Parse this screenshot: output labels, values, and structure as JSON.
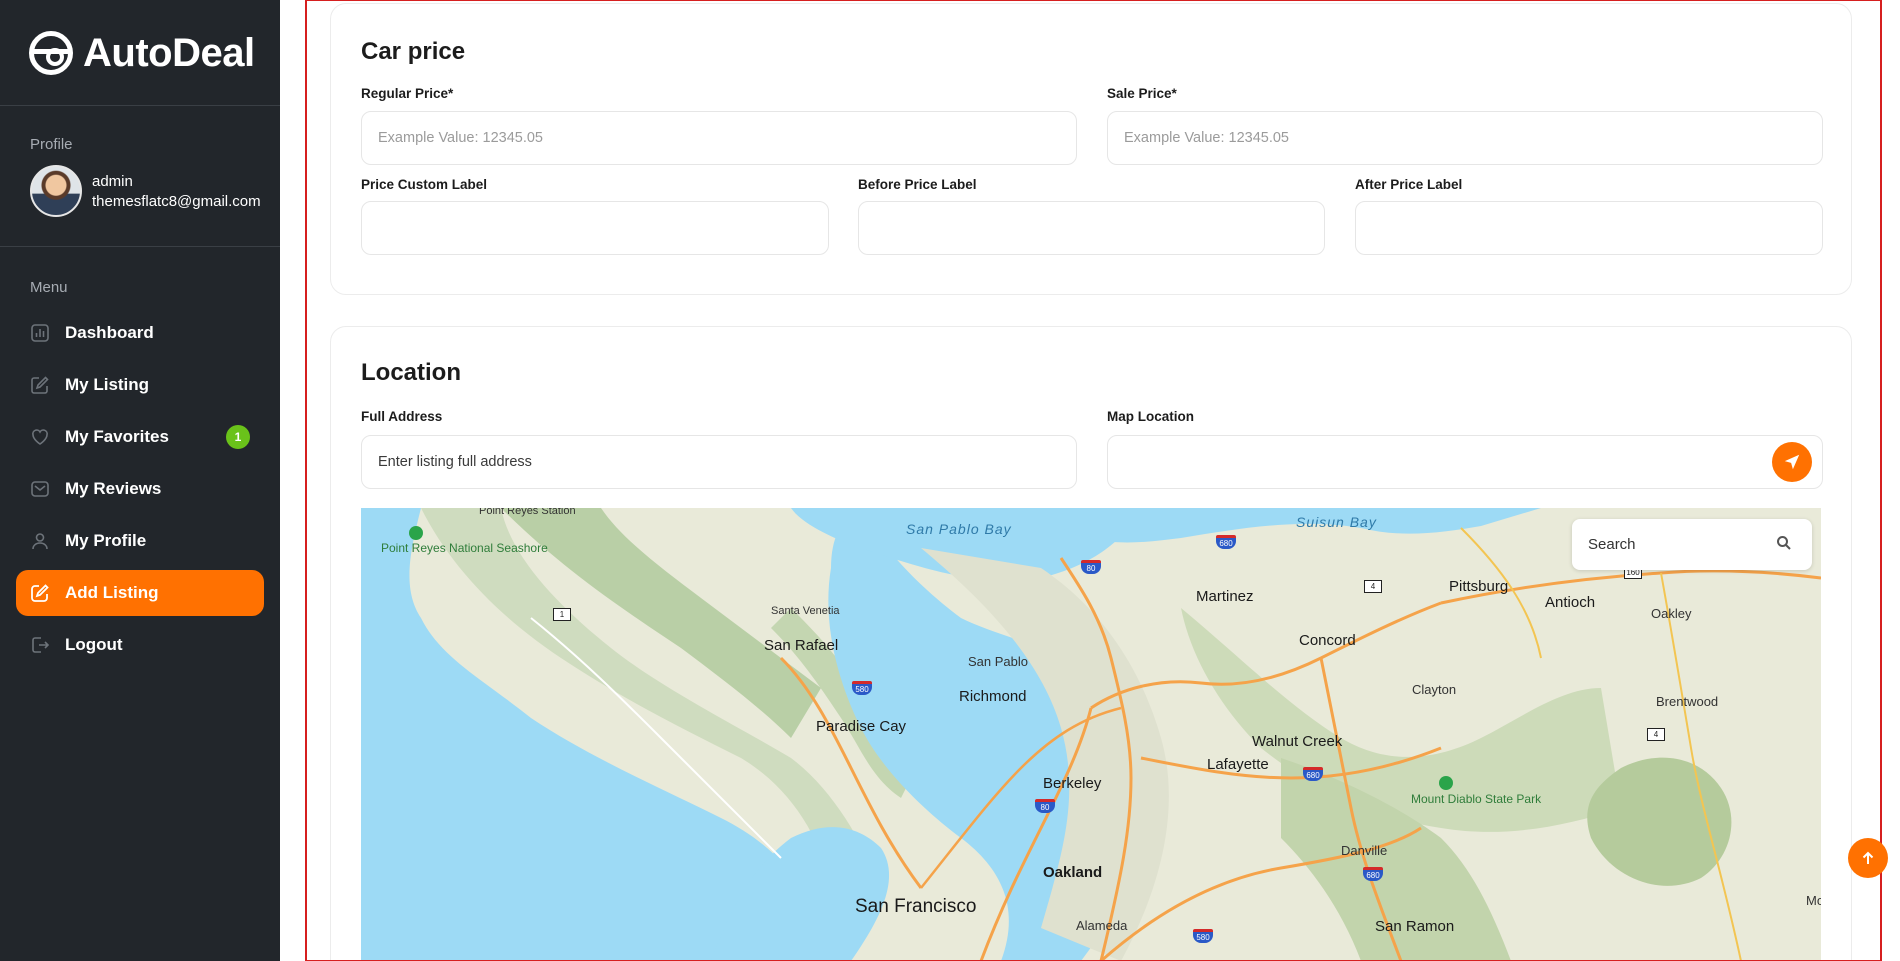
{
  "brand": {
    "name": "AutoDeal"
  },
  "sidebar": {
    "profile_label": "Profile",
    "user": {
      "name": "admin",
      "email": "themesflatc8@gmail.com"
    },
    "menu_label": "Menu",
    "items": [
      {
        "label": "Dashboard",
        "icon": "chart-icon"
      },
      {
        "label": "My Listing",
        "icon": "edit-icon"
      },
      {
        "label": "My Favorites",
        "icon": "heart-icon",
        "badge": "1"
      },
      {
        "label": "My Reviews",
        "icon": "review-icon"
      },
      {
        "label": "My Profile",
        "icon": "user-icon"
      },
      {
        "label": "Add Listing",
        "icon": "add-listing-icon",
        "active": true
      },
      {
        "label": "Logout",
        "icon": "logout-icon"
      }
    ]
  },
  "price": {
    "title": "Car price",
    "regular_label": "Regular Price*",
    "regular_placeholder": "Example Value: 12345.05",
    "sale_label": "Sale Price*",
    "sale_placeholder": "Example Value: 12345.05",
    "custom_label": "Price Custom Label",
    "before_label": "Before Price Label",
    "after_label": "After Price Label"
  },
  "location": {
    "title": "Location",
    "address_label": "Full Address",
    "address_placeholder": "Enter listing full address",
    "map_label": "Map Location",
    "search_placeholder": "Search"
  },
  "map": {
    "places": [
      "Point Reyes Station",
      "Point Reyes National Seashore",
      "San Pablo Bay",
      "Suisun Bay",
      "Martinez",
      "Pittsburg",
      "Antioch",
      "Oakley",
      "Santa Venetia",
      "San Rafael",
      "San Pablo",
      "Richmond",
      "Concord",
      "Clayton",
      "Brentwood",
      "Paradise Cay",
      "Walnut Creek",
      "Lafayette",
      "Berkeley",
      "Mount Diablo State Park",
      "Danville",
      "Oakland",
      "San Francisco",
      "Alameda",
      "San Ramon",
      "Mo"
    ],
    "routes": [
      "80",
      "680",
      "4",
      "160",
      "1",
      "580",
      "80",
      "680",
      "4",
      "680",
      "580"
    ]
  },
  "colors": {
    "accent": "#ff7101",
    "sidebar": "#22262b",
    "badge": "#6ac21a"
  }
}
